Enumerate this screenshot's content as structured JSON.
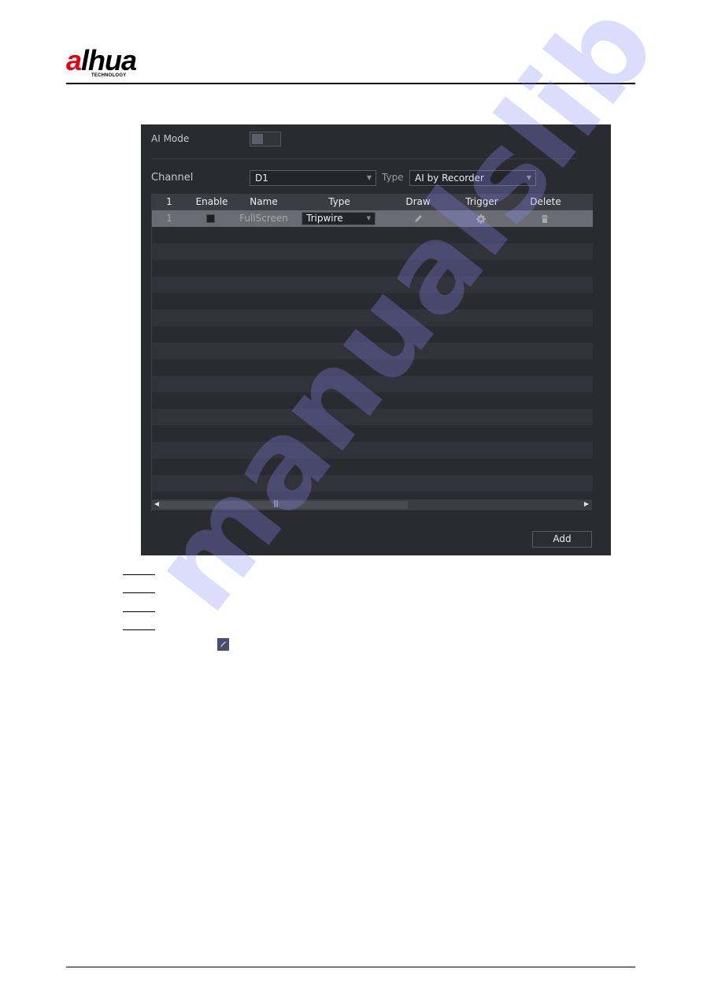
{
  "document": {
    "brand": {
      "logo_red": "a",
      "logo_rest": "lhua",
      "logo_sub": "TECHNOLOGY"
    },
    "watermark": "manualslib"
  },
  "ui": {
    "ai_mode": {
      "label": "AI Mode",
      "enabled": false
    },
    "channel": {
      "label": "Channel",
      "value": "D1"
    },
    "type": {
      "label": "Type",
      "value": "AI by Recorder"
    },
    "table": {
      "columns": [
        "1",
        "Enable",
        "Name",
        "Type",
        "Draw",
        "Trigger",
        "Delete"
      ],
      "rows": [
        {
          "index": "1",
          "enable": false,
          "name": "FullScreen",
          "type": "Tripwire",
          "draw_icon": "pencil-icon",
          "trigger_icon": "gear-icon",
          "delete_icon": "trash-icon"
        }
      ]
    },
    "add_label": "Add"
  },
  "colors": {
    "panel_bg": "#2a2b31",
    "selected_row": "#6b6c73",
    "header_bg": "#3b3c44",
    "brand_red": "#e60012"
  }
}
